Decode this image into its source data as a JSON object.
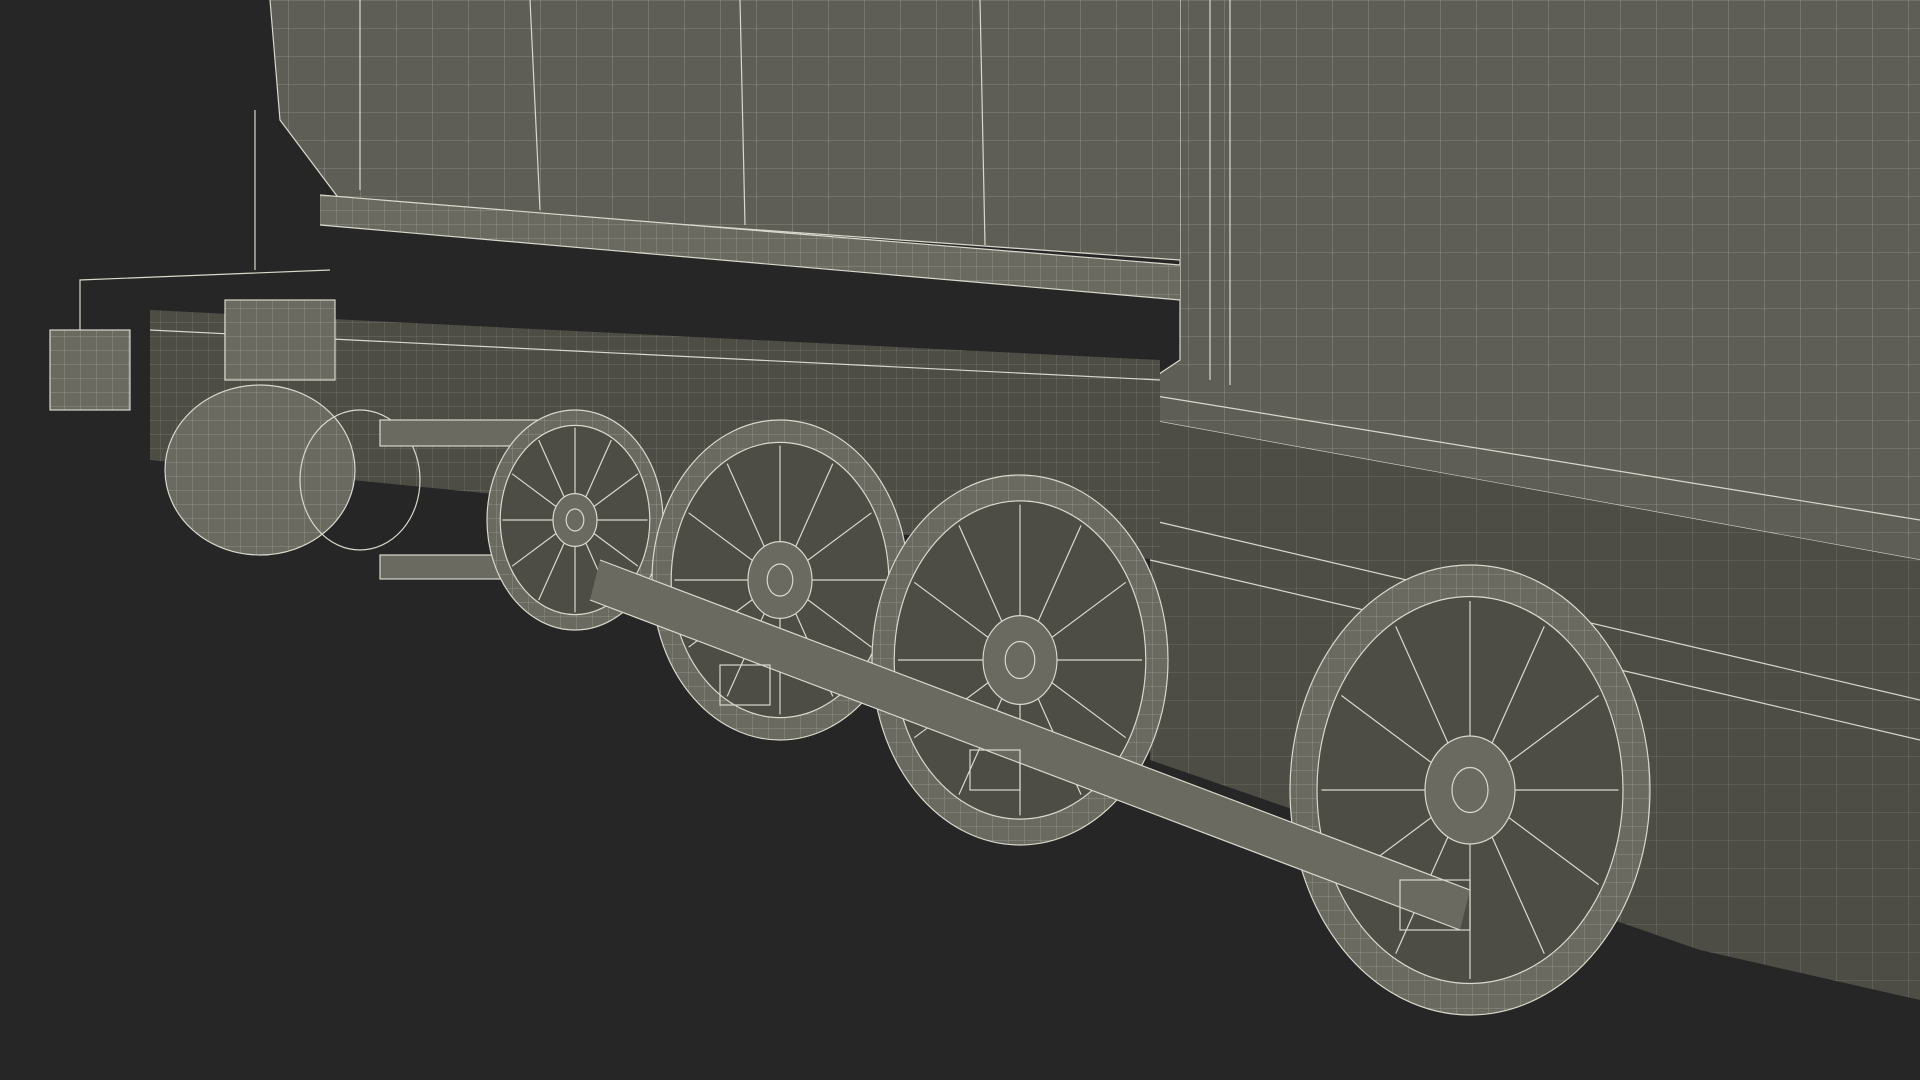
{
  "scene": {
    "subject": "steam-locomotive-wireframe-render",
    "background_color": "#262626",
    "mesh_color": "#5e5e56",
    "wire_color": "#d8d8cc",
    "wheels": [
      {
        "id": "lead-wheel"
      },
      {
        "id": "driver-wheel-1"
      },
      {
        "id": "driver-wheel-2"
      },
      {
        "id": "driver-wheel-3"
      }
    ]
  }
}
